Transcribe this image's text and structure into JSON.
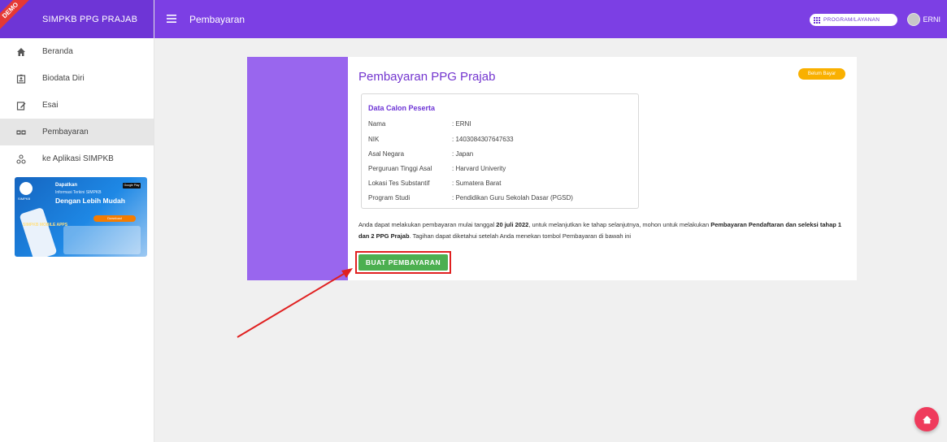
{
  "brand": {
    "ribbon": "DEMO",
    "title": "SIMPKB PPG PRAJAB"
  },
  "sidebar": {
    "items": [
      {
        "label": "Beranda",
        "icon": "home-icon"
      },
      {
        "label": "Biodata Diri",
        "icon": "id-card-icon"
      },
      {
        "label": "Esai",
        "icon": "edit-icon"
      },
      {
        "label": "Pembayaran",
        "icon": "payment-icon",
        "active": true
      },
      {
        "label": "ke Aplikasi SIMPKB",
        "icon": "network-icon"
      }
    ],
    "banner": {
      "logo_text": "SIMPKB",
      "line1": "Dapatkan",
      "line2": "Informasi Terkini SIMPKB",
      "line3": "Dengan Lebih Mudah",
      "store": "Google Play",
      "pill": "Download",
      "apps": "SIMPKB MOBILE APPS"
    }
  },
  "topbar": {
    "heading": "Pembayaran",
    "program_button": "PROGRAM/LAYANAN",
    "user_name": "ERNI"
  },
  "card": {
    "title": "Pembayaran PPG Prajab",
    "status_badge": "Belum Bayar",
    "info_heading": "Data Calon Peserta",
    "rows": [
      {
        "key": "Nama",
        "value": ": ERNI"
      },
      {
        "key": "NIK",
        "value": ": 1403084307647633"
      },
      {
        "key": "Asal Negara",
        "value": ": Japan"
      },
      {
        "key": "Perguruan Tinggi Asal",
        "value": ": Harvard Univerity"
      },
      {
        "key": "Lokasi Tes Substantif",
        "value": ": Sumatera Barat"
      },
      {
        "key": "Program Studi",
        "value": ": Pendidikan Guru Sekolah Dasar (PGSD)"
      }
    ],
    "desc": {
      "p1": "Anda dapat melakukan pembayaran mulai tanggal ",
      "date": "20 juli 2022",
      "p2": ", untuk melanjutkan ke tahap selanjutnya, mohon untuk melakukan ",
      "strong1": "Pembayaran Pendaftaran dan seleksi tahap 1 dan 2 PPG Prajab",
      "p3": ". Tagihan dapat diketahui setelah Anda menekan tombol Pembayaran di bawah ini"
    },
    "pay_button": "BUAT PEMBAYARAN"
  },
  "colors": {
    "topbar": "#7c3fe4",
    "accent_purple": "#7335cf",
    "badge": "#f9b000",
    "button_green": "#4caf50",
    "annotation_red": "#e02020",
    "fab": "#ef3b5c"
  }
}
